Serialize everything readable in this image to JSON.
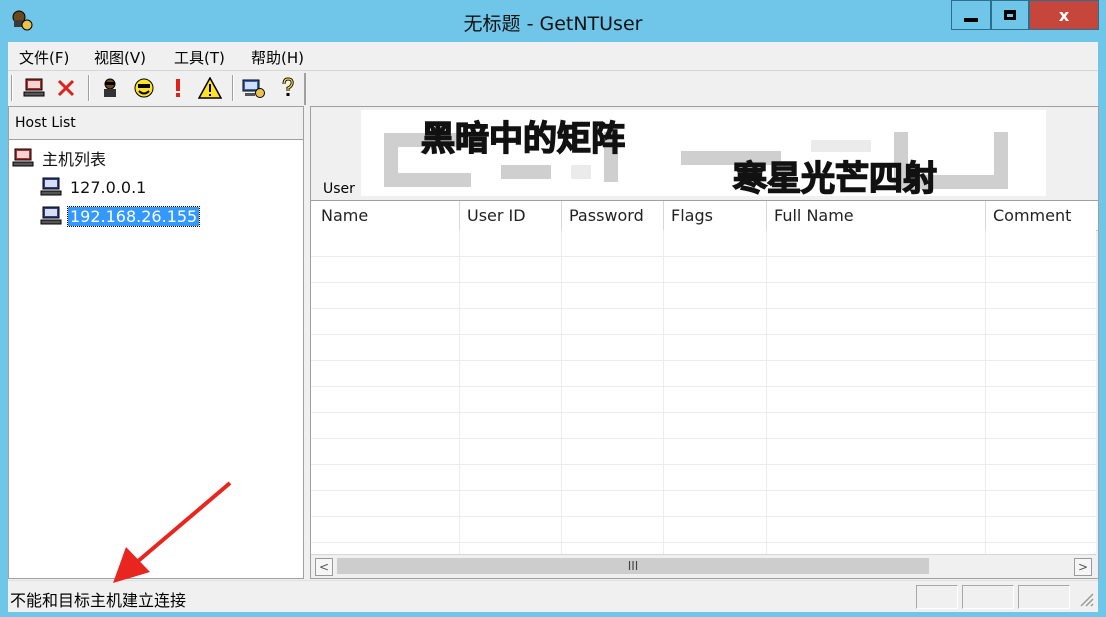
{
  "window": {
    "title": "无标题 - GetNTUser",
    "close_glyph": "x"
  },
  "menu": [
    {
      "label": "文件(F)"
    },
    {
      "label": "视图(V)"
    },
    {
      "label": "工具(T)"
    },
    {
      "label": "帮助(H)"
    }
  ],
  "toolbar": {
    "icons": [
      "computer-icon",
      "delete-x-icon",
      "user-agent-icon",
      "smiley-icon",
      "exclamation-icon",
      "warning-icon",
      "settings-computer-icon",
      "help-question-icon"
    ]
  },
  "host_list": {
    "header": "Host List",
    "root": "主机列表",
    "hosts": [
      "127.0.0.1",
      "192.168.26.155"
    ],
    "selected": "192.168.26.155"
  },
  "banner": {
    "line1": "黑暗中的矩阵",
    "line2": "寒星光芒四射"
  },
  "user_panel": {
    "label": "User",
    "columns": [
      "Name",
      "User ID",
      "Password",
      "Flags",
      "Full Name",
      "Comment"
    ],
    "rows": []
  },
  "scrollbar": {
    "left_arrow": "<",
    "right_arrow": ">",
    "thumb_grip": "III"
  },
  "status": {
    "message": "不能和目标主机建立连接"
  },
  "colors": {
    "titlebar": "#6fc6e9",
    "close": "#c7463c",
    "selection": "#3399ff",
    "annotation_arrow": "#e8261f"
  }
}
